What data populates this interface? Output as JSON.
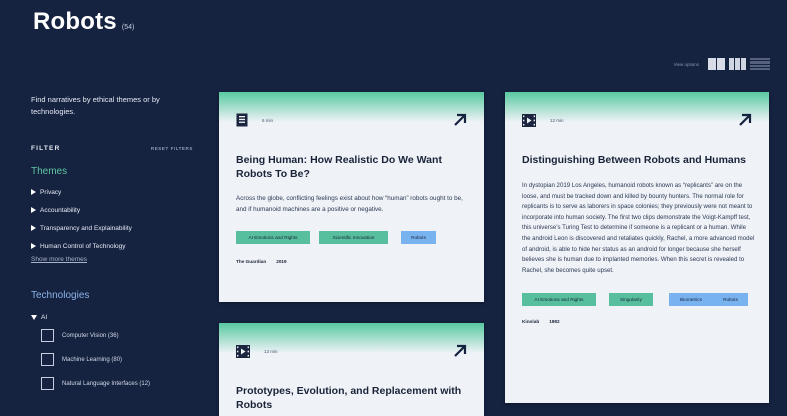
{
  "header": {
    "title": "Robots",
    "count": "(54)"
  },
  "view_options": {
    "label": "View options"
  },
  "sidebar": {
    "intro": "Find narratives by ethical themes or by technologies.",
    "filter_label": "FILTER",
    "reset_label": "RESET FILTERS",
    "themes_heading": "Themes",
    "themes": [
      "Privacy",
      "Accountability",
      "Transparency and Explainability",
      "Human Control of Technology"
    ],
    "show_more": "Show more themes",
    "technologies_heading": "Technologies",
    "ai_label": "AI",
    "technologies": [
      "Computer Vision (36)",
      "Machine Learning (80)",
      "Natural Language Interfaces (12)"
    ]
  },
  "cards": [
    {
      "time": "6 min",
      "title": "Being Human: How Realistic Do We Want Robots To Be?",
      "description": "Across the globe, conflicting feelings exist about how “human” robots ought to be, and if humanoid machines are a positive or negative.",
      "tags": [
        "AI Emotions and Rights",
        "Scientific Innovation",
        "Robots"
      ],
      "source": "The Guardian",
      "year": "2019"
    },
    {
      "time": "12 min",
      "title": "Distinguishing Between Robots and Humans",
      "description": "In dystopian 2019 Los Angeles, humanoid robots known as “replicants” are on the loose, and must be tracked down and killed by bounty hunters. The normal role for replicants is to serve as laborers in space colonies; they previously were not meant to incorporate into human society. The first two clips demonstrate the Voigt-Kampff test, this universe’s Turing Test to determine if someone is a replicant or a human. While the android Leon is discovered and retaliates quickly, Rachel, a more advanced model of android, is able to hide her status as an android for longer because she herself believes she is human due to implanted memories. When this secret is revealed to Rachel, she becomes quite upset.",
      "tags": [
        "AI Emotions and Rights",
        "Singularity",
        "Biometrics",
        "Robots"
      ],
      "source": "Kinolab",
      "year": "1982"
    },
    {
      "time": "13 min",
      "title": "Prototypes, Evolution, and Replacement with Robots"
    }
  ],
  "colors": {
    "background": "#152240",
    "accent_green": "#57bf9d",
    "accent_blue": "#78b2ef",
    "card": "#eff2f7"
  }
}
